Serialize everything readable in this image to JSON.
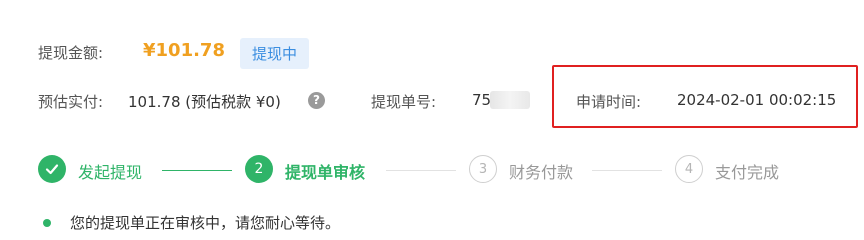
{
  "withdraw": {
    "amount_label": "提现金额:",
    "amount_value": "¥101.78",
    "status_badge": "提现中",
    "estimate_label": "预估实付:",
    "estimate_value": "101.78 (预估税款 ¥0)",
    "help_icon": "question-icon",
    "order_label": "提现单号:",
    "order_value_visible": "75",
    "apply_time_label": "申请时间:",
    "apply_time_value": "2024-02-01 00:02:15"
  },
  "steps": [
    {
      "label": "发起提现",
      "number": "",
      "state": "done",
      "icon": "check-icon"
    },
    {
      "label": "提现单审核",
      "number": "2",
      "state": "active"
    },
    {
      "label": "财务付款",
      "number": "3",
      "state": "waiting"
    },
    {
      "label": "支付完成",
      "number": "4",
      "state": "waiting"
    }
  ],
  "notice": {
    "text": "您的提现单正在审核中，请您耐心等待。"
  },
  "colors": {
    "green": "#2fb468",
    "amount_orange": "#f0a020",
    "badge_blue": "#3b8ee0",
    "highlight_red": "#e02020"
  }
}
